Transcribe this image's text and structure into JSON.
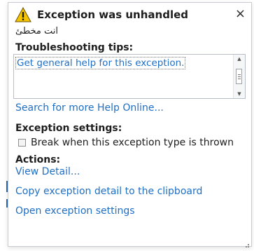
{
  "dialog": {
    "title": "Exception was unhandled",
    "message": "انت مخطئ",
    "close_label": "×"
  },
  "troubleshooting": {
    "heading": "Troubleshooting tips:",
    "tips": [
      "Get general help for this exception."
    ],
    "search_link": "Search for more Help Online..."
  },
  "exception_settings": {
    "heading": "Exception settings:",
    "checkbox_label": "Break when this exception type is thrown",
    "checkbox_checked": false
  },
  "actions": {
    "heading": "Actions:",
    "items": [
      "View Detail...",
      "Copy exception detail to the clipboard",
      "Open exception settings"
    ]
  },
  "colors": {
    "link": "#1f6fc5",
    "warning_fill": "#f5c400",
    "accent_mark": "#2a69b0"
  },
  "icons": {
    "warning": "warning-icon",
    "close": "close-icon",
    "scroll_up": "scroll-up-icon",
    "scroll_down": "scroll-down-icon",
    "resize_grip": "resize-grip-icon"
  }
}
